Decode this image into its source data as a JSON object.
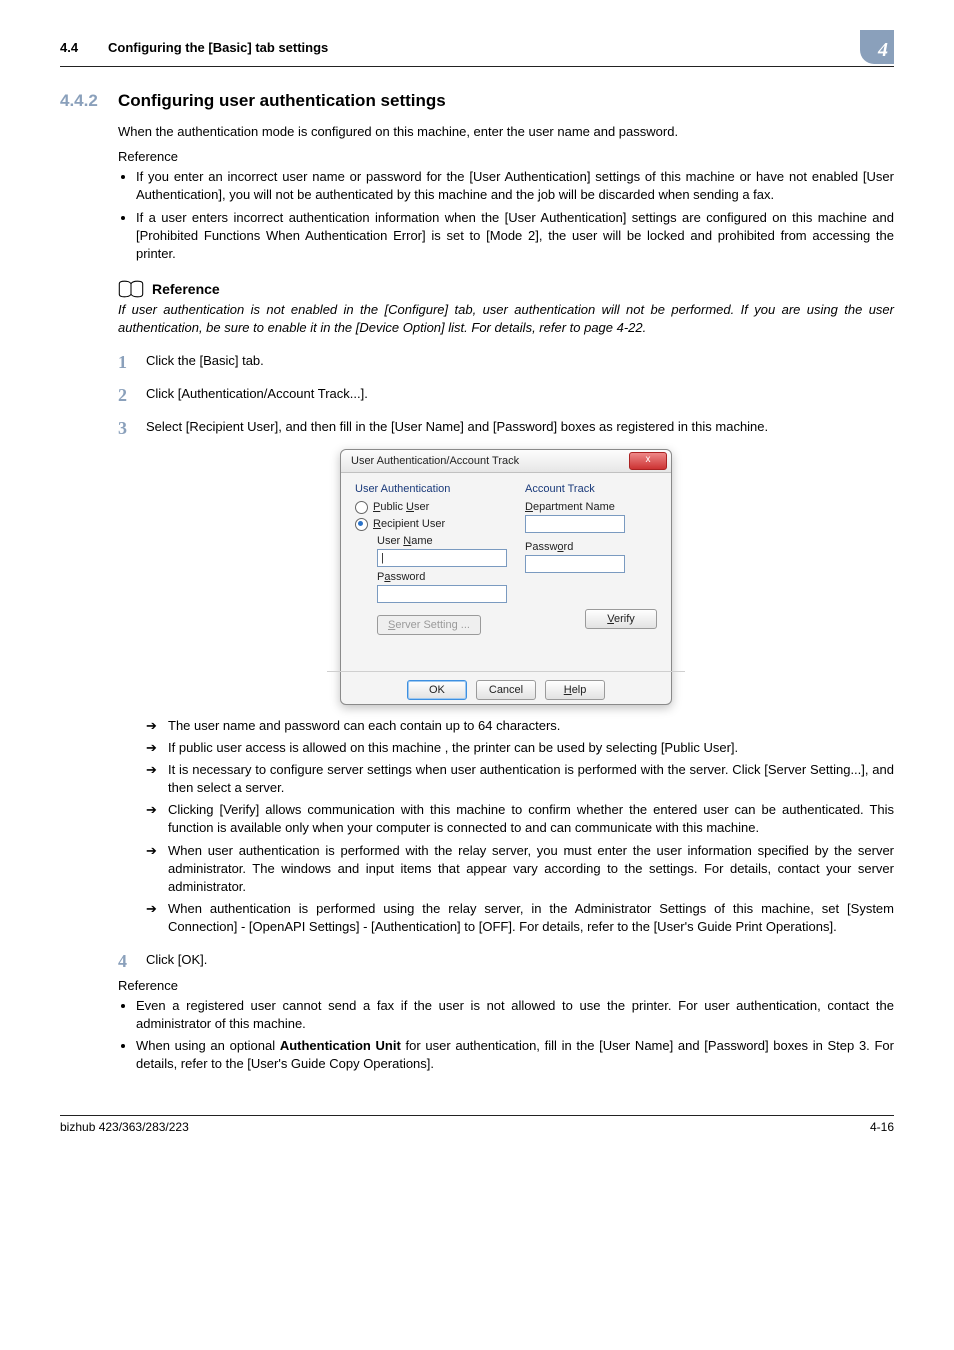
{
  "header": {
    "secnum": "4.4",
    "sectitle": "Configuring the [Basic] tab settings",
    "chapter": "4"
  },
  "h2": {
    "num": "4.4.2",
    "text": "Configuring user authentication settings"
  },
  "intro": "When the authentication mode is configured on this machine, enter the user name and password.",
  "ref_word": "Reference",
  "ref_bullets": [
    "If you enter an incorrect user name or password for the [User Authentication] settings of this machine or have not enabled [User Authentication], you will not be authenticated by this machine and the job will be discarded when sending a fax.",
    "If a user enters incorrect authentication information when the [User Authentication] settings are configured on this machine and [Prohibited Functions When Authentication Error] is set to [Mode 2], the user will be locked and prohibited from accessing the printer."
  ],
  "ref_block_title": "Reference",
  "ref_block_body": "If user authentication is not enabled in the [Configure] tab, user authentication will not be performed. If you are using the user authentication, be sure to enable it in the [Device Option] list. For details, refer to page 4-22.",
  "steps": {
    "s1": {
      "n": "1",
      "t": "Click the [Basic] tab."
    },
    "s2": {
      "n": "2",
      "t": "Click [Authentication/Account Track...]."
    },
    "s3": {
      "n": "3",
      "t": "Select [Recipient User], and then fill in the [User Name] and [Password] boxes as registered in this machine."
    },
    "s4": {
      "n": "4",
      "t": "Click [OK]."
    }
  },
  "dialog": {
    "title": "User Authentication/Account Track",
    "close": "x",
    "left": {
      "heading": "User Authentication",
      "opt_public": "Public User",
      "opt_recipient": "Recipient User",
      "username_label": "User Name",
      "username_value": "|",
      "password_label": "Password",
      "server_setting": "Server Setting ..."
    },
    "right": {
      "heading": "Account Track",
      "dept_label": "Department Name",
      "password_label": "Password",
      "verify": "Verify"
    },
    "buttons": {
      "ok": "OK",
      "cancel": "Cancel",
      "help": "Help"
    }
  },
  "arrows": [
    "The user name and password can each contain up to 64 characters.",
    "If public user access is allowed on this machine , the printer can be used by selecting [Public User].",
    "It is necessary to configure server settings when user authentication is performed with the server. Click [Server Setting...], and then select a server.",
    "Clicking [Verify] allows communication with this machine to confirm whether the entered user can be authenticated. This function is available only when your computer is connected to and can communicate with this machine.",
    "When user authentication is performed with the relay server, you must enter the user information specified by the server administrator. The windows and input items that appear vary according to the settings. For details, contact your server administrator.",
    "When authentication is performed using the relay server, in the Administrator Settings of this machine, set [System Connection] - [OpenAPI Settings] - [Authentication] to [OFF]. For details, refer to the [User's Guide Print Operations]."
  ],
  "ref2": [
    "Even a registered user cannot send a fax if the user is not allowed to use the printer. For user authentication, contact the administrator of this machine."
  ],
  "ref2_html": "When using an optional <b>Authentication Unit</b> for user authentication, fill in the [User Name] and [Password] boxes in Step 3. For details, refer to the [User's Guide Copy Operations].",
  "footer": {
    "left": "bizhub 423/363/283/223",
    "right": "4-16"
  }
}
